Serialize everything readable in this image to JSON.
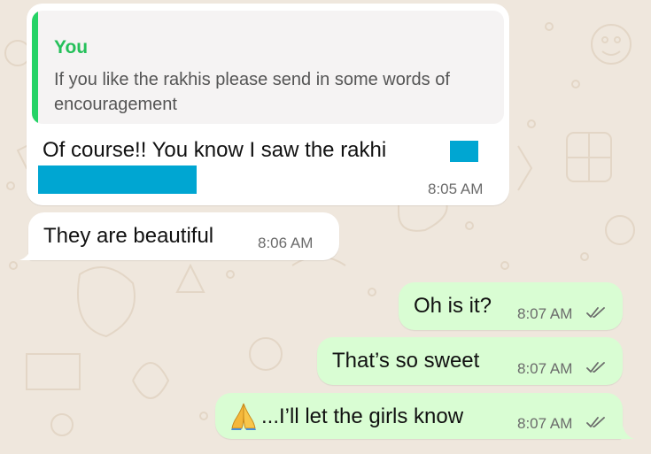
{
  "chat": {
    "quoted": {
      "author": "You",
      "text": "If you like the rakhis please send in some words of encouragement"
    },
    "messages": [
      {
        "side": "incoming",
        "text": "Of course!! You know I saw the rakhi",
        "time": "8:05 AM",
        "redacted": true
      },
      {
        "side": "incoming",
        "text": "They are beautiful",
        "time": "8:06 AM"
      },
      {
        "side": "outgoing",
        "text": "Oh is it?",
        "time": "8:07 AM",
        "status": "read"
      },
      {
        "side": "outgoing",
        "text": "That’s so sweet",
        "time": "8:07 AM",
        "status": "read"
      },
      {
        "side": "outgoing",
        "text": "...I’ll let the girls know",
        "time": "8:07 AM",
        "status": "read",
        "emoji": "folded-hands"
      }
    ]
  },
  "colors": {
    "background": "#efe7dd",
    "incoming_bubble": "#ffffff",
    "outgoing_bubble": "#d9fdd3",
    "quote_accent": "#25d366",
    "redaction": "#00a6d2",
    "read_ticks": "#6b6b6b"
  }
}
